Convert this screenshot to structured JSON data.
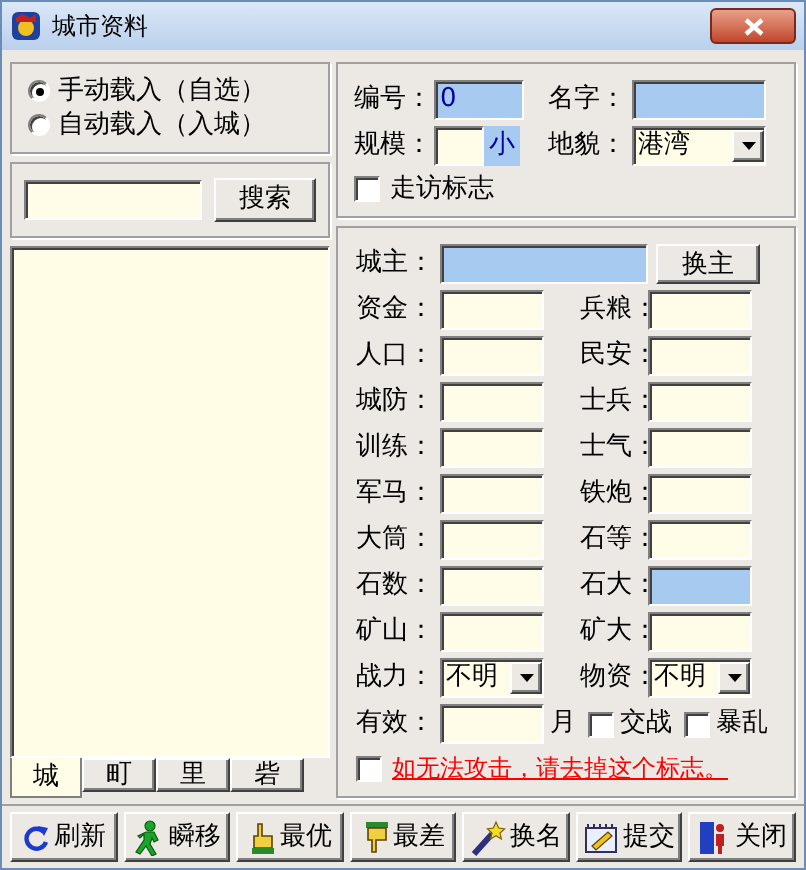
{
  "window": {
    "title": "城市资料"
  },
  "load_mode": [
    {
      "label": "手动载入（自选）",
      "selected": true
    },
    {
      "label": "自动载入（入城）",
      "selected": false
    }
  ],
  "search": {
    "button": "搜索"
  },
  "list_tabs": [
    {
      "label": "城",
      "selected": true
    },
    {
      "label": "町",
      "selected": false
    },
    {
      "label": "里",
      "selected": false
    },
    {
      "label": "砦",
      "selected": false
    }
  ],
  "info": {
    "number": {
      "label": "编号：",
      "value": "0",
      "highlighted": true
    },
    "name": {
      "label": "名字：",
      "highlighted": true
    },
    "scale": {
      "label": "规模：",
      "unit": "小"
    },
    "terrain": {
      "label": "地貌：",
      "value": "港湾"
    },
    "visited": {
      "label": "走访标志",
      "checked": false
    }
  },
  "lord": {
    "label": "城主：",
    "highlighted": true,
    "button": "换主"
  },
  "stats": [
    {
      "kind": "field",
      "label": "资金：",
      "highlighted": false
    },
    {
      "kind": "field",
      "label": "兵粮：",
      "highlighted": false
    },
    {
      "kind": "field",
      "label": "人口：",
      "highlighted": false
    },
    {
      "kind": "field",
      "label": "民安：",
      "highlighted": false
    },
    {
      "kind": "field",
      "label": "城防：",
      "highlighted": false
    },
    {
      "kind": "field",
      "label": "士兵：",
      "highlighted": false
    },
    {
      "kind": "field",
      "label": "训练：",
      "highlighted": false
    },
    {
      "kind": "field",
      "label": "士气：",
      "highlighted": false
    },
    {
      "kind": "field",
      "label": "军马：",
      "highlighted": false
    },
    {
      "kind": "field",
      "label": "铁炮：",
      "highlighted": false
    },
    {
      "kind": "field",
      "label": "大筒：",
      "highlighted": false
    },
    {
      "kind": "field",
      "label": "石等：",
      "highlighted": false
    },
    {
      "kind": "field",
      "label": "石数：",
      "highlighted": false
    },
    {
      "kind": "field",
      "label": "石大：",
      "highlighted": true
    },
    {
      "kind": "field",
      "label": "矿山：",
      "highlighted": false
    },
    {
      "kind": "field",
      "label": "矿大：",
      "highlighted": false
    },
    {
      "kind": "select",
      "label": "战力：",
      "value": "不明"
    },
    {
      "kind": "select",
      "label": "物资：",
      "value": "不明"
    }
  ],
  "effective": {
    "label": "有效：",
    "unit": "月"
  },
  "flags": [
    {
      "label": "交战",
      "checked": false
    },
    {
      "label": "暴乱",
      "checked": false
    }
  ],
  "warning": {
    "label": "如无法攻击，请去掉这个标志。",
    "checked": false
  },
  "toolbar": [
    {
      "kind": "refresh",
      "label": "刷新"
    },
    {
      "kind": "teleport",
      "label": "瞬移"
    },
    {
      "kind": "best",
      "label": "最优"
    },
    {
      "kind": "worst",
      "label": "最差"
    },
    {
      "kind": "rename",
      "label": "换名"
    },
    {
      "kind": "submit",
      "label": "提交"
    },
    {
      "kind": "close",
      "label": "关闭"
    }
  ]
}
